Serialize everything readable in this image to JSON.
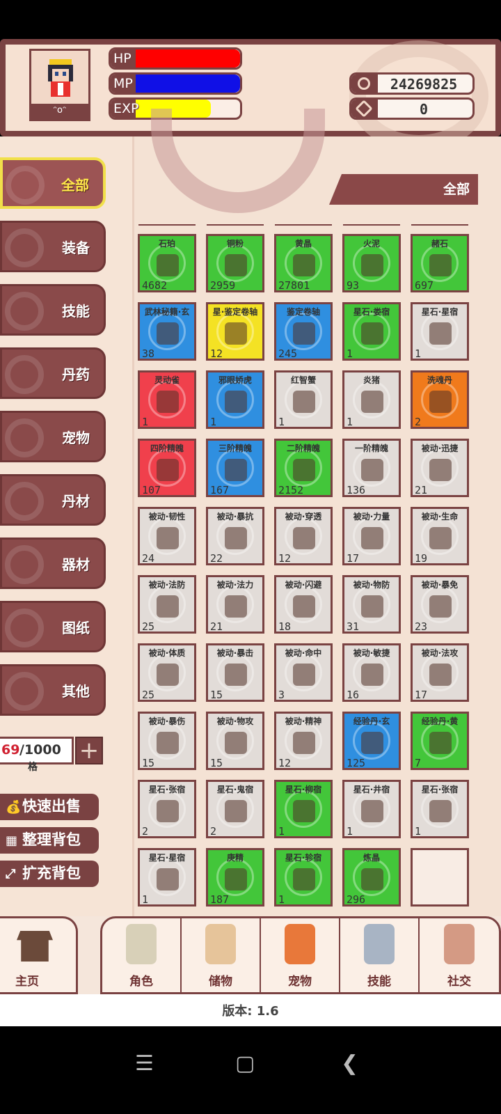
{
  "header": {
    "avatar_caption": "ᵔoᵔ",
    "bars": [
      {
        "label": "HP",
        "fill_pct": 100,
        "color": "#ff0000"
      },
      {
        "label": "MP",
        "fill_pct": 100,
        "color": "#1010e6"
      },
      {
        "label": "EXP",
        "fill_pct": 72,
        "color": "#ffff00"
      }
    ],
    "currencies": [
      {
        "icon": "coin-icon",
        "value": "24269825"
      },
      {
        "icon": "gem-icon",
        "value": "0"
      }
    ]
  },
  "sidebar": {
    "categories": [
      {
        "label": "全部",
        "active": true
      },
      {
        "label": "装备",
        "active": false
      },
      {
        "label": "技能",
        "active": false
      },
      {
        "label": "丹药",
        "active": false
      },
      {
        "label": "宠物",
        "active": false
      },
      {
        "label": "丹材",
        "active": false
      },
      {
        "label": "器材",
        "active": false
      },
      {
        "label": "图纸",
        "active": false
      },
      {
        "label": "其他",
        "active": false
      }
    ],
    "capacity": {
      "current": "69",
      "max": "/1000",
      "unit": "格"
    },
    "actions": [
      {
        "icon": "bag-icon",
        "label": "快速出售"
      },
      {
        "icon": "grid-icon",
        "label": "整理背包"
      },
      {
        "icon": "expand-icon",
        "label": "扩充背包"
      }
    ]
  },
  "filter": {
    "label": "全部"
  },
  "items": [
    {
      "name": "石珀",
      "qty": "4682",
      "grade": "green"
    },
    {
      "name": "铜粉",
      "qty": "2959",
      "grade": "green"
    },
    {
      "name": "黄晶",
      "qty": "27801",
      "grade": "green"
    },
    {
      "name": "火泥",
      "qty": "93",
      "grade": "green"
    },
    {
      "name": "赭石",
      "qty": "697",
      "grade": "green"
    },
    {
      "name": "武林秘籍·玄",
      "qty": "38",
      "grade": "blue"
    },
    {
      "name": "星·鉴定卷轴",
      "qty": "12",
      "grade": "yellow"
    },
    {
      "name": "鉴定卷轴",
      "qty": "245",
      "grade": "blue"
    },
    {
      "name": "星石·娄宿",
      "qty": "1",
      "grade": "green"
    },
    {
      "name": "星石·星宿",
      "qty": "1",
      "grade": "gray"
    },
    {
      "name": "灵动雀",
      "qty": "1",
      "grade": "red"
    },
    {
      "name": "邪眼娇虎",
      "qty": "1",
      "grade": "blue"
    },
    {
      "name": "红智蟹",
      "qty": "1",
      "grade": "gray"
    },
    {
      "name": "炎猪",
      "qty": "1",
      "grade": "gray"
    },
    {
      "name": "洗魂丹",
      "qty": "2",
      "grade": "orange"
    },
    {
      "name": "四阶精魄",
      "qty": "107",
      "grade": "red"
    },
    {
      "name": "三阶精魄",
      "qty": "167",
      "grade": "blue"
    },
    {
      "name": "二阶精魄",
      "qty": "2152",
      "grade": "green"
    },
    {
      "name": "一阶精魄",
      "qty": "136",
      "grade": "gray"
    },
    {
      "name": "被动·迅捷",
      "qty": "21",
      "grade": "gray"
    },
    {
      "name": "被动·韧性",
      "qty": "24",
      "grade": "gray"
    },
    {
      "name": "被动·暴抗",
      "qty": "22",
      "grade": "gray"
    },
    {
      "name": "被动·穿透",
      "qty": "12",
      "grade": "gray"
    },
    {
      "name": "被动·力量",
      "qty": "17",
      "grade": "gray"
    },
    {
      "name": "被动·生命",
      "qty": "19",
      "grade": "gray"
    },
    {
      "name": "被动·法防",
      "qty": "25",
      "grade": "gray"
    },
    {
      "name": "被动·法力",
      "qty": "21",
      "grade": "gray"
    },
    {
      "name": "被动·闪避",
      "qty": "18",
      "grade": "gray"
    },
    {
      "name": "被动·物防",
      "qty": "31",
      "grade": "gray"
    },
    {
      "name": "被动·暴免",
      "qty": "23",
      "grade": "gray"
    },
    {
      "name": "被动·体质",
      "qty": "25",
      "grade": "gray"
    },
    {
      "name": "被动·暴击",
      "qty": "15",
      "grade": "gray"
    },
    {
      "name": "被动·命中",
      "qty": "3",
      "grade": "gray"
    },
    {
      "name": "被动·敏捷",
      "qty": "16",
      "grade": "gray"
    },
    {
      "name": "被动·法攻",
      "qty": "17",
      "grade": "gray"
    },
    {
      "name": "被动·暴伤",
      "qty": "15",
      "grade": "gray"
    },
    {
      "name": "被动·物攻",
      "qty": "15",
      "grade": "gray"
    },
    {
      "name": "被动·精神",
      "qty": "12",
      "grade": "gray"
    },
    {
      "name": "经验丹·玄",
      "qty": "125",
      "grade": "blue"
    },
    {
      "name": "经验丹·黄",
      "qty": "7",
      "grade": "green"
    },
    {
      "name": "星石·张宿",
      "qty": "2",
      "grade": "gray"
    },
    {
      "name": "星石·鬼宿",
      "qty": "2",
      "grade": "gray"
    },
    {
      "name": "星石·柳宿",
      "qty": "1",
      "grade": "green"
    },
    {
      "name": "星石·井宿",
      "qty": "1",
      "grade": "gray"
    },
    {
      "name": "星石·张宿",
      "qty": "1",
      "grade": "gray"
    },
    {
      "name": "星石·星宿",
      "qty": "1",
      "grade": "gray"
    },
    {
      "name": "庚精",
      "qty": "187",
      "grade": "green"
    },
    {
      "name": "星石·轸宿",
      "qty": "1",
      "grade": "green"
    },
    {
      "name": "炼晶",
      "qty": "296",
      "grade": "green"
    },
    {
      "name": "",
      "qty": "",
      "grade": "empty"
    }
  ],
  "tabbar": {
    "home": {
      "label": "主页",
      "icon": "house-icon"
    },
    "tabs": [
      {
        "label": "角色",
        "icon": "character-icon",
        "color": "#d8d0b8"
      },
      {
        "label": "储物",
        "icon": "sack-icon",
        "color": "#e6c49a"
      },
      {
        "label": "宠物",
        "icon": "fox-icon",
        "color": "#e8783a"
      },
      {
        "label": "技能",
        "icon": "sword-icon",
        "color": "#a8b4c4"
      },
      {
        "label": "社交",
        "icon": "handshake-icon",
        "color": "#d49a84"
      }
    ]
  },
  "version": "版本: 1.6",
  "grade_colors": {
    "green": "#43c63a",
    "blue": "#2f8fe0",
    "yellow": "#f4e224",
    "red": "#f0404c",
    "orange": "#f07a1c",
    "gray": "#e2dcd8"
  }
}
